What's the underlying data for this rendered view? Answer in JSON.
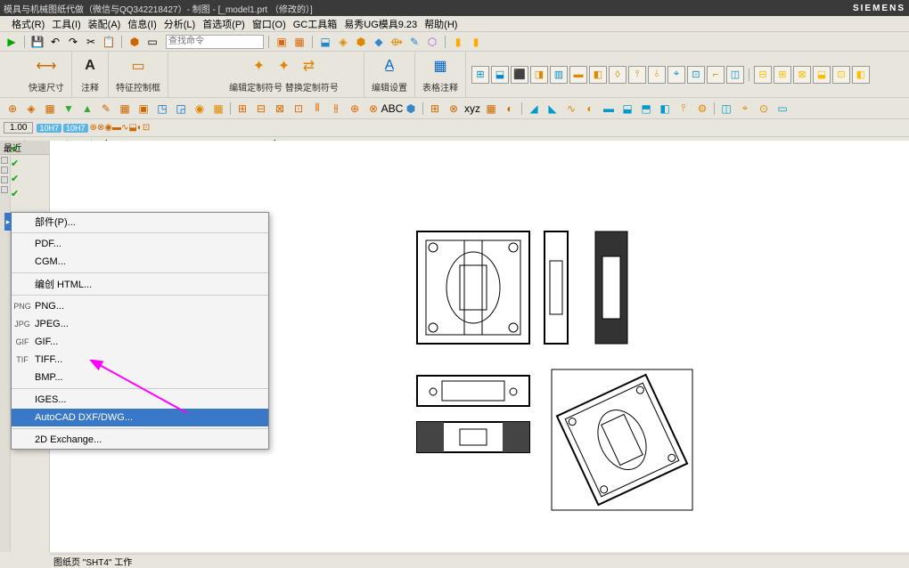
{
  "titlebar": {
    "title": "模具与机械图纸代做（微信与QQ342218427）- 制图 - [_model1.prt （修改的）]",
    "brand": "SIEMENS"
  },
  "menubar": {
    "items": [
      "格式(R)",
      "工具(I)",
      "装配(A)",
      "信息(I)",
      "分析(L)",
      "首选项(P)",
      "窗口(O)",
      "GC工具箱",
      "易秀UG模具9.23",
      "帮助(H)"
    ]
  },
  "ribbon": {
    "groups": [
      {
        "label": "快速尺寸"
      },
      {
        "label": "注释"
      },
      {
        "label": "特征控制框"
      },
      {
        "label": "定制符号",
        "sub": "编辑定制符号  替换定制符号"
      },
      {
        "label": "编辑设置"
      },
      {
        "label": "表格注释"
      }
    ]
  },
  "toolbar": {
    "lbl100": "1.00",
    "tag1": "10H7",
    "tag2": "10H7"
  },
  "context_menu": {
    "items": [
      {
        "label": "部件(P)...",
        "icon": ""
      },
      {
        "label": "PDF...",
        "icon": ""
      },
      {
        "label": "CGM...",
        "icon": ""
      },
      {
        "label": "编创 HTML...",
        "icon": ""
      },
      {
        "label": "PNG...",
        "icon": "PNG"
      },
      {
        "label": "JPEG...",
        "icon": "JPG"
      },
      {
        "label": "GIF...",
        "icon": "GIF"
      },
      {
        "label": "TIFF...",
        "icon": "TIF"
      },
      {
        "label": "BMP...",
        "icon": ""
      },
      {
        "label": "IGES...",
        "icon": ""
      },
      {
        "label": "AutoCAD DXF/DWG...",
        "icon": "",
        "highlighted": true
      },
      {
        "label": "2D Exchange...",
        "icon": ""
      }
    ]
  },
  "sidebar": {
    "header": "最近"
  },
  "statusbar": {
    "text": "图纸页 \"SHT4\" 工作"
  },
  "search": {
    "placeholder": "查找命令"
  }
}
